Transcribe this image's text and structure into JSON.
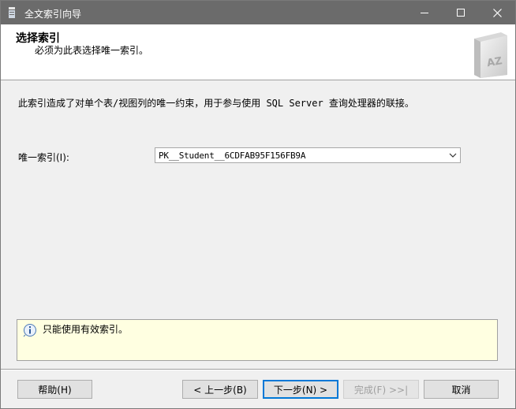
{
  "window": {
    "title": "全文索引向导",
    "controls": {
      "minimize": "minimize-icon",
      "maximize": "maximize-icon",
      "close": "close-icon"
    }
  },
  "header": {
    "title": "选择索引",
    "subtitle": "必须为此表选择唯一索引。",
    "icon": "az-book-icon"
  },
  "body": {
    "description": "此索引造成了对单个表/视图列的唯一约束，用于参与使用 SQL Server 查询处理器的联接。",
    "unique_index_label": "唯一索引(I):",
    "unique_index_value": "PK__Student__6CDFAB95F156FB9A"
  },
  "info": {
    "icon": "info-icon",
    "text": "只能使用有效索引。"
  },
  "footer": {
    "help": "帮助(H)",
    "back": "< 上一步(B)",
    "next": "下一步(N) >",
    "finish": "完成(F) >>|",
    "cancel": "取消"
  },
  "colors": {
    "titlebar": "#6b6b6b",
    "info_bg": "#ffffe1",
    "focus_border": "#0078d7"
  }
}
